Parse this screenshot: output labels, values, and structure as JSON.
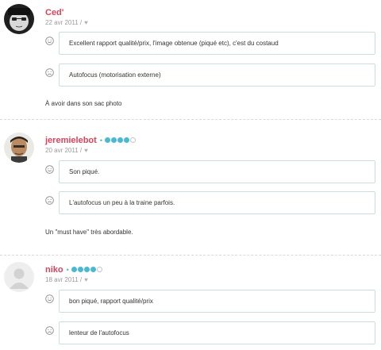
{
  "reviews": [
    {
      "author": "Ced'",
      "date": "22 avr 2011 /",
      "rating": null,
      "pros": "Excellent rapport qualité/prix, l'image obtenue (piqué etc), c'est du costaud",
      "cons": "Autofocus (motorisation externe)",
      "summary": "À avoir dans son sac photo"
    },
    {
      "author": "jeremielebot",
      "date": "20 avr 2011 /",
      "rating": 4,
      "rating_max": 5,
      "pros": "Son piqué.",
      "cons": "L'autofocus un peu à la traine parfois.",
      "summary": "Un \"must have\" très abordable."
    },
    {
      "author": "niko",
      "date": "18 avr 2011 /",
      "rating": 4,
      "rating_max": 5,
      "pros": "bon piqué, rapport qualité/prix",
      "cons": "lenteur de l'autofocus"
    }
  ],
  "icons": {
    "like": "heart-icon",
    "pro": "smiley-happy-icon",
    "con": "smiley-sad-icon",
    "separator": "•"
  },
  "colors": {
    "author": "#d9445b",
    "star": "#49b9d3",
    "bubble_border": "#c9dde2"
  }
}
